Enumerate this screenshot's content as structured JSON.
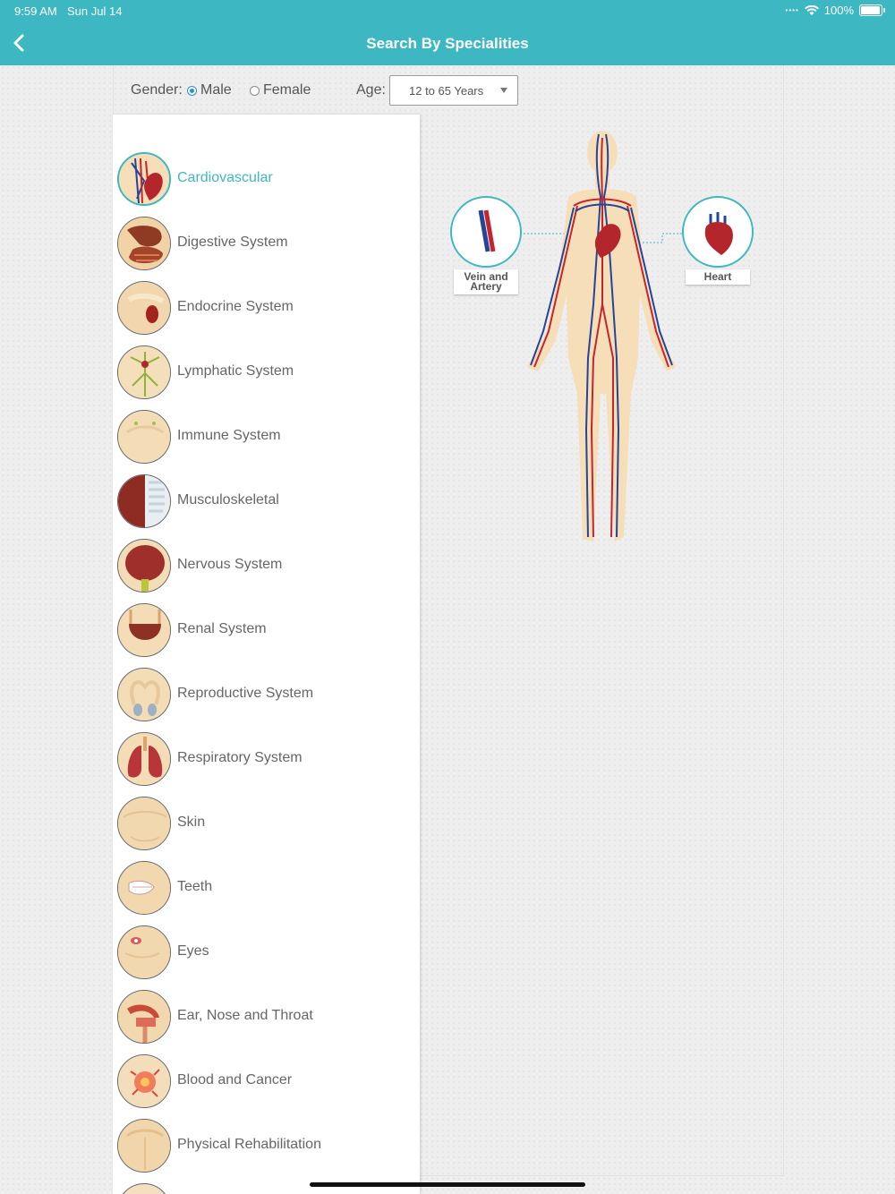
{
  "status_bar": {
    "time": "9:59 AM",
    "date": "Sun Jul 14",
    "battery": "100%"
  },
  "nav": {
    "title": "Search By Specialities"
  },
  "filters": {
    "gender_label": "Gender:",
    "gender_options": [
      "Male",
      "Female"
    ],
    "gender_selected": "Male",
    "age_label": "Age:",
    "age_value": "12 to 65 Years"
  },
  "specialities": [
    {
      "label": "Cardiovascular",
      "icon": "heart-vessels-icon",
      "active": true
    },
    {
      "label": "Digestive System",
      "icon": "stomach-icon"
    },
    {
      "label": "Endocrine System",
      "icon": "kidney-gland-icon"
    },
    {
      "label": "Lymphatic System",
      "icon": "lymph-nodes-icon"
    },
    {
      "label": "Immune System",
      "icon": "torso-immune-icon"
    },
    {
      "label": "Musculoskeletal",
      "icon": "muscle-bone-icon"
    },
    {
      "label": "Nervous System",
      "icon": "brain-icon"
    },
    {
      "label": "Renal System",
      "icon": "bladder-icon"
    },
    {
      "label": "Reproductive System",
      "icon": "reproductive-icon"
    },
    {
      "label": "Respiratory System",
      "icon": "lungs-icon"
    },
    {
      "label": "Skin",
      "icon": "skin-torso-icon"
    },
    {
      "label": "Teeth",
      "icon": "teeth-icon"
    },
    {
      "label": "Eyes",
      "icon": "eye-face-icon"
    },
    {
      "label": "Ear, Nose and Throat",
      "icon": "ent-head-icon"
    },
    {
      "label": "Blood and Cancer",
      "icon": "cancer-cell-icon"
    },
    {
      "label": "Physical Rehabilitation",
      "icon": "back-torso-icon"
    }
  ],
  "callouts": {
    "left": {
      "label": "Vein and Artery",
      "icon": "vein-artery-icon"
    },
    "right": {
      "label": "Heart",
      "icon": "heart-icon"
    }
  },
  "colors": {
    "accent": "#3db8c2",
    "artery": "#c4262e",
    "vein": "#24459a",
    "skin": "#f6dfb8"
  }
}
